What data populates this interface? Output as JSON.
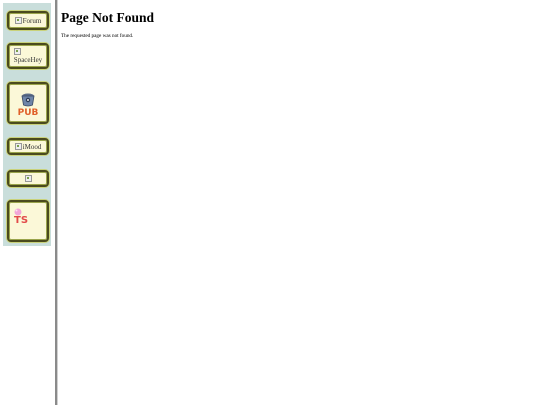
{
  "sidebar": {
    "badges": [
      {
        "alt": "Forum"
      },
      {
        "alt": "SpaceHey"
      },
      {
        "alt": "PUB"
      },
      {
        "alt": "iMood"
      },
      {
        "alt": ""
      },
      {
        "alt": "TS"
      }
    ]
  },
  "main": {
    "title": "Page Not Found",
    "message": "The requested page was not found."
  },
  "colors": {
    "sidebar_bg": "#c9dedb",
    "badge_bg": "#fbf8d8",
    "badge_border": "#4b4b1e"
  }
}
